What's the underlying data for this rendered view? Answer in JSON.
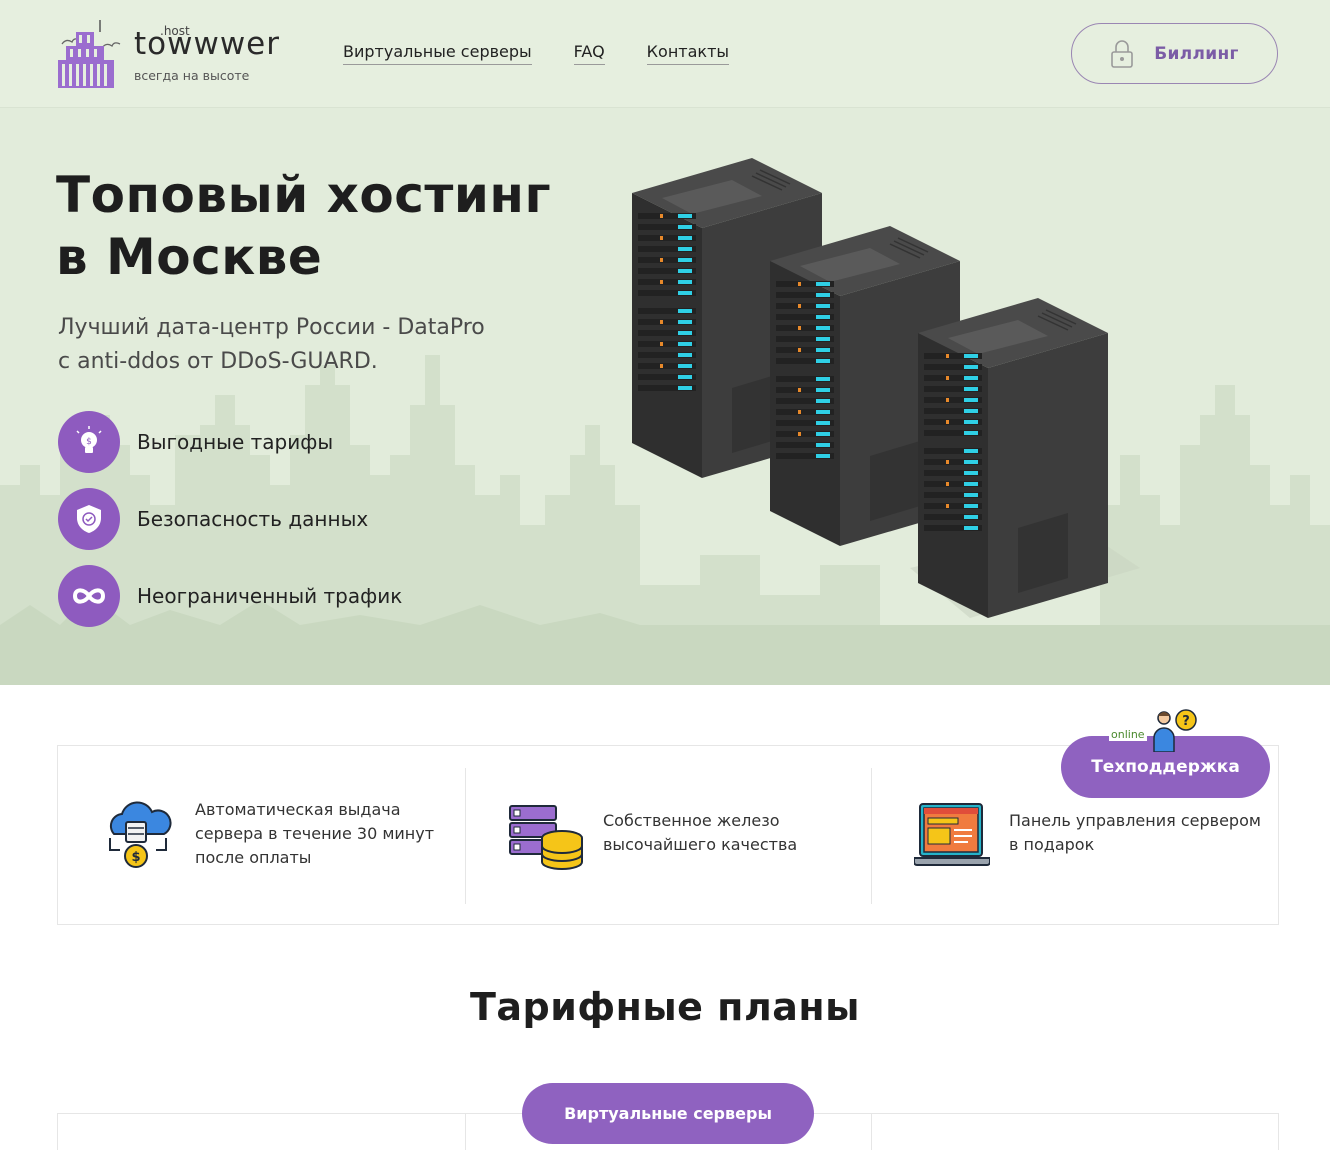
{
  "header": {
    "logo": {
      "tag": ".host",
      "name": "towwwer",
      "slogan": "всегда на высоте"
    },
    "nav": [
      {
        "label": "Виртуальные серверы"
      },
      {
        "label": "FAQ"
      },
      {
        "label": "Контакты"
      }
    ],
    "billing": {
      "label": "Биллинг",
      "icon": "lock-icon"
    }
  },
  "hero": {
    "title_line1": "Топовый хостинг",
    "title_line2": "в Москве",
    "subtitle_line1": "Лучший дата-центр России - DataPro",
    "subtitle_line2": "с anti-ddos от DDoS-GUARD.",
    "features": [
      {
        "label": "Выгодные тарифы",
        "icon": "lightbulb-dollar-icon"
      },
      {
        "label": "Безопасность данных",
        "icon": "shield-check-icon"
      },
      {
        "label": "Неограниченный трафик",
        "icon": "infinity-icon"
      }
    ]
  },
  "advantages": [
    {
      "text": "Автоматическая выдача сервера в течение 30 минут после оплаты",
      "icon": "cloud-server-payment-icon"
    },
    {
      "text": "Собственное железо высочайшего качества",
      "icon": "server-database-icon"
    },
    {
      "text": "Панель управления сервером в подарок",
      "icon": "control-panel-laptop-icon"
    }
  ],
  "support": {
    "label": "Техподдержка",
    "status": "online"
  },
  "tariffs": {
    "title": "Тарифные планы",
    "active_tab": "Виртуальные серверы"
  },
  "colors": {
    "accent": "#8f62c0",
    "hero_bg": "#e2ecdb",
    "header_bg": "#e6efdf"
  }
}
